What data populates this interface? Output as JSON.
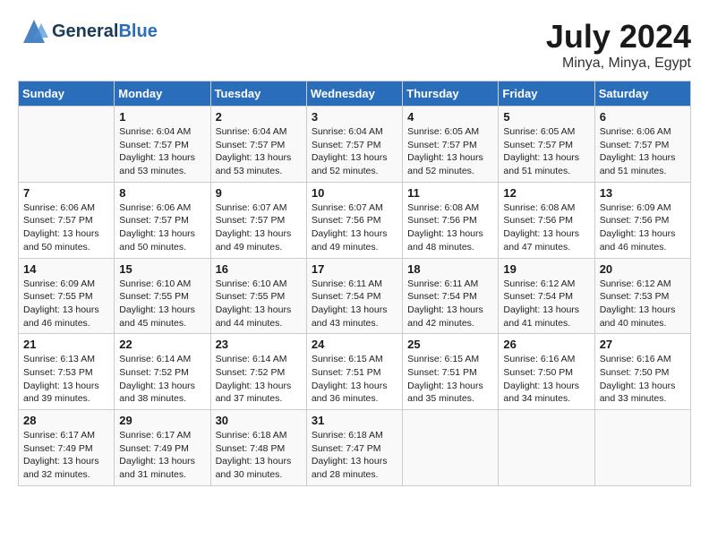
{
  "logo": {
    "general": "General",
    "blue": "Blue"
  },
  "header": {
    "month": "July 2024",
    "location": "Minya, Minya, Egypt"
  },
  "columns": [
    "Sunday",
    "Monday",
    "Tuesday",
    "Wednesday",
    "Thursday",
    "Friday",
    "Saturday"
  ],
  "weeks": [
    [
      {
        "day": "",
        "info": ""
      },
      {
        "day": "1",
        "info": "Sunrise: 6:04 AM\nSunset: 7:57 PM\nDaylight: 13 hours\nand 53 minutes."
      },
      {
        "day": "2",
        "info": "Sunrise: 6:04 AM\nSunset: 7:57 PM\nDaylight: 13 hours\nand 53 minutes."
      },
      {
        "day": "3",
        "info": "Sunrise: 6:04 AM\nSunset: 7:57 PM\nDaylight: 13 hours\nand 52 minutes."
      },
      {
        "day": "4",
        "info": "Sunrise: 6:05 AM\nSunset: 7:57 PM\nDaylight: 13 hours\nand 52 minutes."
      },
      {
        "day": "5",
        "info": "Sunrise: 6:05 AM\nSunset: 7:57 PM\nDaylight: 13 hours\nand 51 minutes."
      },
      {
        "day": "6",
        "info": "Sunrise: 6:06 AM\nSunset: 7:57 PM\nDaylight: 13 hours\nand 51 minutes."
      }
    ],
    [
      {
        "day": "7",
        "info": "Sunrise: 6:06 AM\nSunset: 7:57 PM\nDaylight: 13 hours\nand 50 minutes."
      },
      {
        "day": "8",
        "info": "Sunrise: 6:06 AM\nSunset: 7:57 PM\nDaylight: 13 hours\nand 50 minutes."
      },
      {
        "day": "9",
        "info": "Sunrise: 6:07 AM\nSunset: 7:57 PM\nDaylight: 13 hours\nand 49 minutes."
      },
      {
        "day": "10",
        "info": "Sunrise: 6:07 AM\nSunset: 7:56 PM\nDaylight: 13 hours\nand 49 minutes."
      },
      {
        "day": "11",
        "info": "Sunrise: 6:08 AM\nSunset: 7:56 PM\nDaylight: 13 hours\nand 48 minutes."
      },
      {
        "day": "12",
        "info": "Sunrise: 6:08 AM\nSunset: 7:56 PM\nDaylight: 13 hours\nand 47 minutes."
      },
      {
        "day": "13",
        "info": "Sunrise: 6:09 AM\nSunset: 7:56 PM\nDaylight: 13 hours\nand 46 minutes."
      }
    ],
    [
      {
        "day": "14",
        "info": "Sunrise: 6:09 AM\nSunset: 7:55 PM\nDaylight: 13 hours\nand 46 minutes."
      },
      {
        "day": "15",
        "info": "Sunrise: 6:10 AM\nSunset: 7:55 PM\nDaylight: 13 hours\nand 45 minutes."
      },
      {
        "day": "16",
        "info": "Sunrise: 6:10 AM\nSunset: 7:55 PM\nDaylight: 13 hours\nand 44 minutes."
      },
      {
        "day": "17",
        "info": "Sunrise: 6:11 AM\nSunset: 7:54 PM\nDaylight: 13 hours\nand 43 minutes."
      },
      {
        "day": "18",
        "info": "Sunrise: 6:11 AM\nSunset: 7:54 PM\nDaylight: 13 hours\nand 42 minutes."
      },
      {
        "day": "19",
        "info": "Sunrise: 6:12 AM\nSunset: 7:54 PM\nDaylight: 13 hours\nand 41 minutes."
      },
      {
        "day": "20",
        "info": "Sunrise: 6:12 AM\nSunset: 7:53 PM\nDaylight: 13 hours\nand 40 minutes."
      }
    ],
    [
      {
        "day": "21",
        "info": "Sunrise: 6:13 AM\nSunset: 7:53 PM\nDaylight: 13 hours\nand 39 minutes."
      },
      {
        "day": "22",
        "info": "Sunrise: 6:14 AM\nSunset: 7:52 PM\nDaylight: 13 hours\nand 38 minutes."
      },
      {
        "day": "23",
        "info": "Sunrise: 6:14 AM\nSunset: 7:52 PM\nDaylight: 13 hours\nand 37 minutes."
      },
      {
        "day": "24",
        "info": "Sunrise: 6:15 AM\nSunset: 7:51 PM\nDaylight: 13 hours\nand 36 minutes."
      },
      {
        "day": "25",
        "info": "Sunrise: 6:15 AM\nSunset: 7:51 PM\nDaylight: 13 hours\nand 35 minutes."
      },
      {
        "day": "26",
        "info": "Sunrise: 6:16 AM\nSunset: 7:50 PM\nDaylight: 13 hours\nand 34 minutes."
      },
      {
        "day": "27",
        "info": "Sunrise: 6:16 AM\nSunset: 7:50 PM\nDaylight: 13 hours\nand 33 minutes."
      }
    ],
    [
      {
        "day": "28",
        "info": "Sunrise: 6:17 AM\nSunset: 7:49 PM\nDaylight: 13 hours\nand 32 minutes."
      },
      {
        "day": "29",
        "info": "Sunrise: 6:17 AM\nSunset: 7:49 PM\nDaylight: 13 hours\nand 31 minutes."
      },
      {
        "day": "30",
        "info": "Sunrise: 6:18 AM\nSunset: 7:48 PM\nDaylight: 13 hours\nand 30 minutes."
      },
      {
        "day": "31",
        "info": "Sunrise: 6:18 AM\nSunset: 7:47 PM\nDaylight: 13 hours\nand 28 minutes."
      },
      {
        "day": "",
        "info": ""
      },
      {
        "day": "",
        "info": ""
      },
      {
        "day": "",
        "info": ""
      }
    ]
  ]
}
